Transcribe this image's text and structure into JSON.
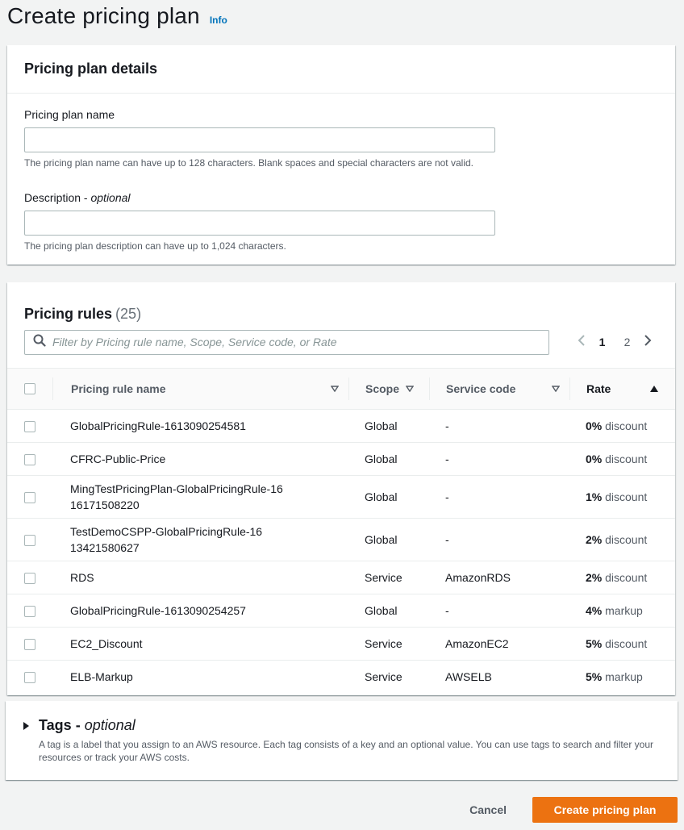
{
  "page": {
    "title": "Create pricing plan",
    "info_label": "Info"
  },
  "details": {
    "title": "Pricing plan details",
    "name_label": "Pricing plan name",
    "name_value": "",
    "name_hint": "The pricing plan name can have up to 128 characters. Blank spaces and special characters are not valid.",
    "desc_label": "Description",
    "desc_optional": "optional",
    "desc_value": "",
    "desc_hint": "The pricing plan description can have up to 1,024 characters."
  },
  "rules": {
    "title": "Pricing rules",
    "count": "(25)",
    "filter_placeholder": "Filter by Pricing rule name, Scope, Service code, or Rate",
    "pages": [
      "1",
      "2"
    ],
    "current_page": "1",
    "columns": {
      "name": "Pricing rule name",
      "scope": "Scope",
      "code": "Service code",
      "rate": "Rate"
    },
    "rows": [
      {
        "name": "GlobalPricingRule-1613090254581",
        "scope": "Global",
        "code": "-",
        "pct": "0%",
        "unit": "discount"
      },
      {
        "name": "CFRC-Public-Price",
        "scope": "Global",
        "code": "-",
        "pct": "0%",
        "unit": "discount"
      },
      {
        "name": "MingTestPricingPlan-GlobalPricingRule-1616171508220",
        "scope": "Global",
        "code": "-",
        "pct": "1%",
        "unit": "discount"
      },
      {
        "name": "TestDemoCSPP-GlobalPricingRule-1613421580627",
        "scope": "Global",
        "code": "-",
        "pct": "2%",
        "unit": "discount"
      },
      {
        "name": "RDS",
        "scope": "Service",
        "code": "AmazonRDS",
        "pct": "2%",
        "unit": "discount"
      },
      {
        "name": "GlobalPricingRule-1613090254257",
        "scope": "Global",
        "code": "-",
        "pct": "4%",
        "unit": "markup"
      },
      {
        "name": "EC2_Discount",
        "scope": "Service",
        "code": "AmazonEC2",
        "pct": "5%",
        "unit": "discount"
      },
      {
        "name": "ELB-Markup",
        "scope": "Service",
        "code": "AWSELB",
        "pct": "5%",
        "unit": "markup"
      }
    ]
  },
  "tags": {
    "title": "Tags",
    "optional": "optional",
    "description": "A tag is a label that you assign to an AWS resource. Each tag consists of a key and an optional value. You can use tags to search and filter your resources or track your AWS costs."
  },
  "actions": {
    "cancel_label": "Cancel",
    "submit_label": "Create pricing plan"
  },
  "colors": {
    "primary": "#ec7211",
    "link": "#0073bb",
    "background": "#f2f3f3"
  }
}
